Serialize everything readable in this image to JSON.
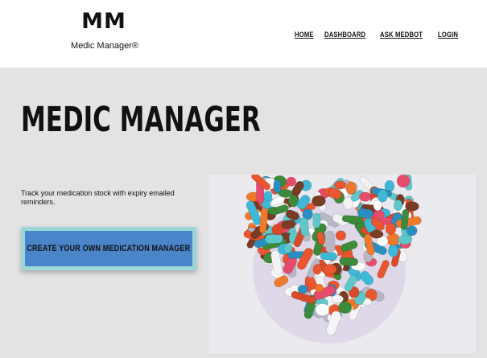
{
  "brand": {
    "mark": "MM",
    "name": "Medic Manager®"
  },
  "nav": {
    "items": [
      {
        "label": "HOME"
      },
      {
        "label": "DASHBOARD"
      },
      {
        "label": "ASK MEDBOT"
      },
      {
        "label": "LOGIN"
      }
    ]
  },
  "hero": {
    "title": "MEDIC MANAGER",
    "tagline": "Track your medication stock with expiry emailed reminders.",
    "cta_label": "CREATE YOUR OWN MEDICATION MANAGER",
    "image_alt": "heart-shaped pile of pills"
  },
  "colors": {
    "header_bg": "#ffffff",
    "hero_bg": "#e3e3e3",
    "cta_bg": "#4a84c9",
    "cta_border": "#9ad7d6"
  }
}
